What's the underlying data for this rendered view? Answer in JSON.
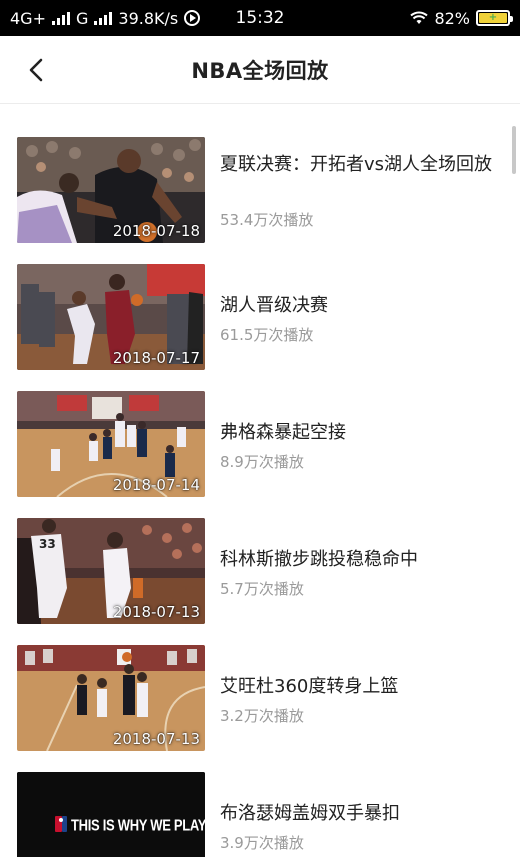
{
  "status_bar": {
    "network1": "4G+",
    "network2": "G",
    "speed": "39.8K/s",
    "time": "15:32",
    "battery": "82%"
  },
  "header": {
    "title": "NBA全场回放"
  },
  "videos": [
    {
      "title": "夏联决赛：开拓者vs湖人全场回放",
      "views": "53.4万次播放",
      "date": "2018-07-18",
      "thumb": "blazers-lakers"
    },
    {
      "title": "湖人晋级决赛",
      "views": "61.5万次播放",
      "date": "2018-07-17",
      "thumb": "lakers-cavs"
    },
    {
      "title": "弗格森暴起空接",
      "views": "8.9万次播放",
      "date": "2018-07-14",
      "thumb": "court-alleyoop"
    },
    {
      "title": "科林斯撤步跳投稳稳命中",
      "views": "5.7万次播放",
      "date": "2018-07-13",
      "thumb": "collins-jumper"
    },
    {
      "title": "艾旺杜360度转身上篮",
      "views": "3.2万次播放",
      "date": "2018-07-13",
      "thumb": "court-layup"
    },
    {
      "title": "布洛瑟姆盖姆双手暴扣",
      "views": "3.9万次播放",
      "date": "",
      "thumb": "this-is-why-we-play",
      "thumb_text": "THIS IS WHY WE PLAY"
    }
  ]
}
